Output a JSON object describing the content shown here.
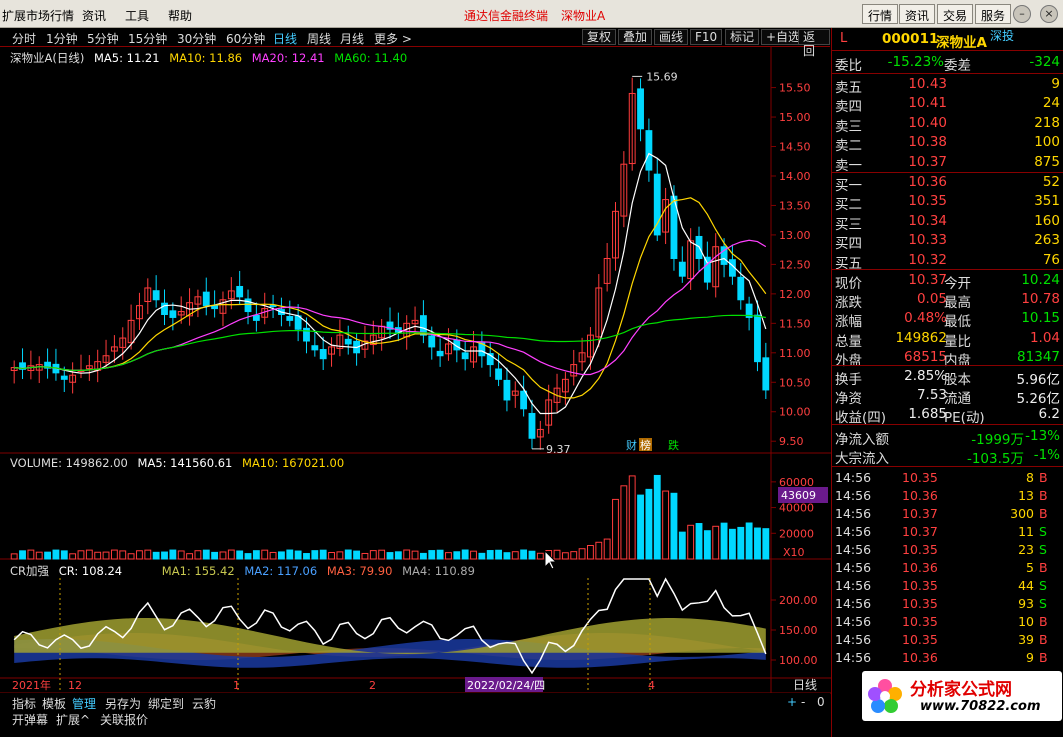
{
  "menu": {
    "items": [
      "扩展市场行情",
      "资讯",
      "工具",
      "帮助"
    ],
    "center_items": [
      "通达信金融终端",
      "深物业A"
    ],
    "right_buttons": [
      "行情",
      "资讯",
      "交易",
      "服务"
    ]
  },
  "toolbar": {
    "periods": [
      "分时",
      "1分钟",
      "5分钟",
      "15分钟",
      "30分钟",
      "60分钟",
      "日线",
      "周线",
      "月线",
      "更多 >"
    ],
    "selected_period": "日线",
    "buttons": [
      "复权",
      "叠加",
      "画线",
      "F10",
      "标记",
      "+自选",
      "返回"
    ]
  },
  "main_legend": {
    "name": "深物业A(日线)",
    "ma5": "MA5: 11.21",
    "ma10": "MA10: 11.86",
    "ma20": "MA20: 12.41",
    "ma60": "MA60: 11.40"
  },
  "volume_legend": {
    "volume": "VOLUME: 149862.00",
    "ma5": "MA5: 141560.61",
    "ma10": "MA10: 167021.00"
  },
  "cr_legend": {
    "name": "CR加强",
    "cr": "CR: 108.24",
    "ma1": "MA1: 155.42",
    "ma2": "MA2: 117.06",
    "ma3": "MA3: 79.90",
    "ma4": "MA4: 110.89"
  },
  "chart_annotations": {
    "high": "15.69",
    "low": "9.37",
    "tag_finance": "财",
    "tag_rank": "榜",
    "tag_drop": "跌",
    "vol_current": "43609",
    "vol_unit": "X10",
    "date_cursor": "2022/02/24/四",
    "x_labels": [
      "2021年",
      "12",
      "1",
      "2",
      "3",
      "4"
    ],
    "period_label": "日线"
  },
  "colors": {
    "up": "#ff3c3c",
    "down": "#00d8ff",
    "ma5": "#ffffff",
    "ma10": "#ffd700",
    "ma20": "#ff40ff",
    "ma60": "#00e000",
    "grid": "#800000"
  },
  "chart_data": {
    "type": "line",
    "title": "深物业A(日线)",
    "price_axis": [
      "15.50",
      "15.00",
      "14.50",
      "14.00",
      "13.50",
      "13.00",
      "12.50",
      "12.00",
      "11.50",
      "11.00",
      "10.50",
      "10.00",
      "9.50"
    ],
    "volume_axis": [
      "60000",
      "40000",
      "20000"
    ],
    "cr_axis": [
      "200.00",
      "150.00",
      "100.00"
    ],
    "ylim": [
      9.3,
      15.9
    ],
    "high": 15.69,
    "low": 9.37,
    "close_series": [
      10.75,
      10.72,
      10.78,
      10.8,
      10.74,
      10.66,
      10.55,
      10.62,
      10.7,
      10.78,
      10.85,
      10.95,
      11.1,
      11.25,
      11.55,
      11.8,
      12.1,
      11.9,
      11.65,
      11.6,
      11.7,
      11.85,
      11.95,
      11.8,
      11.75,
      11.9,
      12.05,
      11.95,
      11.7,
      11.55,
      11.75,
      11.8,
      11.65,
      11.55,
      11.4,
      11.2,
      11.05,
      10.9,
      11.1,
      11.3,
      11.15,
      11.0,
      11.2,
      11.3,
      11.45,
      11.4,
      11.35,
      11.5,
      11.55,
      11.3,
      11.1,
      10.95,
      11.15,
      11.05,
      10.9,
      11.1,
      10.95,
      10.8,
      10.55,
      10.2,
      10.35,
      10.05,
      9.55,
      9.7,
      10.2,
      10.4,
      10.55,
      10.8,
      11.0,
      11.3,
      12.1,
      12.6,
      13.4,
      14.2,
      15.4,
      14.8,
      14.1,
      13.0,
      13.6,
      12.6,
      12.3,
      12.9,
      12.6,
      12.2,
      12.8,
      12.5,
      12.3,
      11.9,
      11.6,
      10.85,
      10.37
    ]
  },
  "quote": {
    "code": "000011",
    "name": "深物业A",
    "market": "深投",
    "flag": "L",
    "webi_label": "委比",
    "webi_value": "-15.23%",
    "wecha_label": "委差",
    "wecha_value": "-324",
    "asks": [
      {
        "label": "卖五",
        "price": "10.43",
        "vol": "9"
      },
      {
        "label": "卖四",
        "price": "10.41",
        "vol": "24"
      },
      {
        "label": "卖三",
        "price": "10.40",
        "vol": "218"
      },
      {
        "label": "卖二",
        "price": "10.38",
        "vol": "100"
      },
      {
        "label": "卖一",
        "price": "10.37",
        "vol": "875"
      }
    ],
    "bids": [
      {
        "label": "买一",
        "price": "10.36",
        "vol": "52"
      },
      {
        "label": "买二",
        "price": "10.35",
        "vol": "351"
      },
      {
        "label": "买三",
        "price": "10.34",
        "vol": "160"
      },
      {
        "label": "买四",
        "price": "10.33",
        "vol": "263"
      },
      {
        "label": "买五",
        "price": "10.32",
        "vol": "76"
      }
    ],
    "stats": [
      {
        "l": "现价",
        "v": "10.37",
        "vc": "red",
        "l2": "今开",
        "v2": "10.24",
        "v2c": "green"
      },
      {
        "l": "涨跌",
        "v": "0.05",
        "vc": "red",
        "l2": "最高",
        "v2": "10.78",
        "v2c": "red"
      },
      {
        "l": "涨幅",
        "v": "0.48%",
        "vc": "red",
        "l2": "最低",
        "v2": "10.15",
        "v2c": "green"
      },
      {
        "l": "总量",
        "v": "149862",
        "vc": "yellow",
        "l2": "量比",
        "v2": "1.04",
        "v2c": "red"
      },
      {
        "l": "外盘",
        "v": "68515",
        "vc": "red",
        "l2": "内盘",
        "v2": "81347",
        "v2c": "green"
      }
    ],
    "stats2": [
      {
        "l": "换手",
        "v": "2.85%",
        "vc": "white",
        "l2": "股本",
        "v2": "5.96亿",
        "v2c": "white"
      },
      {
        "l": "净资",
        "v": "7.53",
        "vc": "white",
        "l2": "流通",
        "v2": "5.26亿",
        "v2c": "white"
      },
      {
        "l": "收益(四)",
        "v": "1.685",
        "vc": "white",
        "l2": "PE(动)",
        "v2": "6.2",
        "v2c": "white"
      }
    ],
    "netflow_label": "净流入额",
    "netflow_value": "-1999万",
    "netflow_pct": "-13%",
    "block_label": "大宗流入",
    "block_value": "-103.5万",
    "block_pct": "-1%",
    "ticks": [
      {
        "t": "14:56",
        "p": "10.35",
        "v": "8",
        "bs": "B"
      },
      {
        "t": "14:56",
        "p": "10.36",
        "v": "13",
        "bs": "B"
      },
      {
        "t": "14:56",
        "p": "10.37",
        "v": "300",
        "bs": "B"
      },
      {
        "t": "14:56",
        "p": "10.37",
        "v": "11",
        "bs": "S"
      },
      {
        "t": "14:56",
        "p": "10.35",
        "v": "23",
        "bs": "S"
      },
      {
        "t": "14:56",
        "p": "10.36",
        "v": "5",
        "bs": "B"
      },
      {
        "t": "14:56",
        "p": "10.35",
        "v": "44",
        "bs": "S"
      },
      {
        "t": "14:56",
        "p": "10.35",
        "v": "93",
        "bs": "S"
      },
      {
        "t": "14:56",
        "p": "10.35",
        "v": "10",
        "bs": "B"
      },
      {
        "t": "14:56",
        "p": "10.35",
        "v": "39",
        "bs": "B"
      },
      {
        "t": "14:56",
        "p": "10.36",
        "v": "9",
        "bs": "B"
      }
    ]
  },
  "bottom_tabs": {
    "row1": [
      "指标",
      "模板",
      "管理",
      "另存为",
      "绑定到",
      "云豹"
    ],
    "row2": [
      "开弹幕",
      "扩展^",
      "关联报价"
    ],
    "active": "管理"
  },
  "logo": {
    "text": "分析家公式网",
    "url": "www.70822.com"
  }
}
